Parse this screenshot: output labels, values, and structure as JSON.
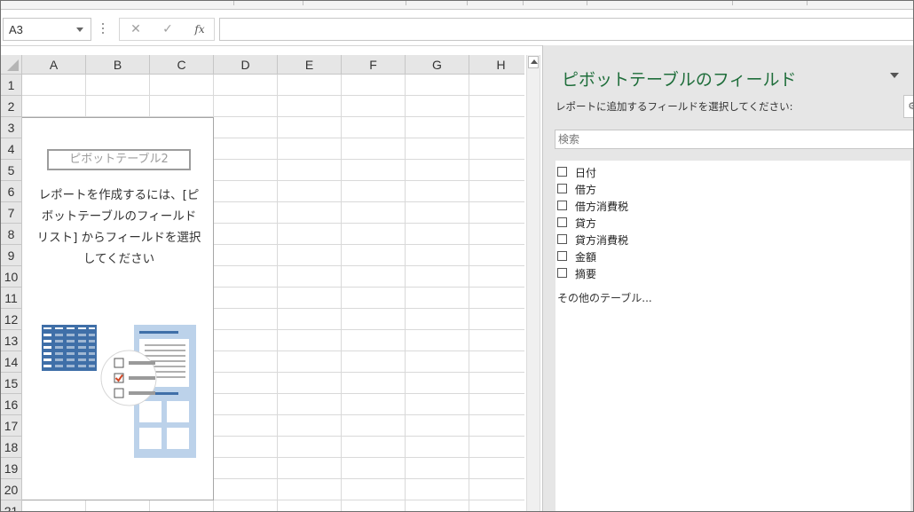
{
  "formula_bar": {
    "name_box": "A3",
    "cancel_icon": "✕",
    "enter_icon": "✓",
    "function_icon": "fx",
    "formula": ""
  },
  "grid": {
    "columns": [
      "A",
      "B",
      "C",
      "D",
      "E",
      "F",
      "G",
      "H"
    ],
    "rows": [
      "1",
      "2",
      "3",
      "4",
      "5",
      "6",
      "7",
      "8",
      "9",
      "10",
      "11",
      "12",
      "13",
      "14",
      "15",
      "16",
      "17",
      "18",
      "19",
      "20",
      "21"
    ]
  },
  "pivot_placeholder": {
    "name": "ピボットテーブル2",
    "message_lines": [
      "レポートを作成するには、[ピ",
      "ボットテーブルのフィールド",
      "リスト] からフィールドを選択",
      "してください"
    ]
  },
  "field_pane": {
    "title": "ピボットテーブルのフィールド",
    "subtitle": "レポートに追加するフィールドを選択してください:",
    "search_placeholder": "検索",
    "fields": [
      {
        "label": "日付",
        "checked": false
      },
      {
        "label": "借方",
        "checked": false
      },
      {
        "label": "借方消費税",
        "checked": false
      },
      {
        "label": "貸方",
        "checked": false
      },
      {
        "label": "貸方消費税",
        "checked": false
      },
      {
        "label": "金額",
        "checked": false
      },
      {
        "label": "摘要",
        "checked": false
      }
    ],
    "more_tables": "その他のテーブル..."
  },
  "colors": {
    "pane_title": "#1f6e3b",
    "illustration_blue": "#3f6fa8",
    "illustration_light": "#bcd2ea",
    "check_red": "#d24726"
  }
}
